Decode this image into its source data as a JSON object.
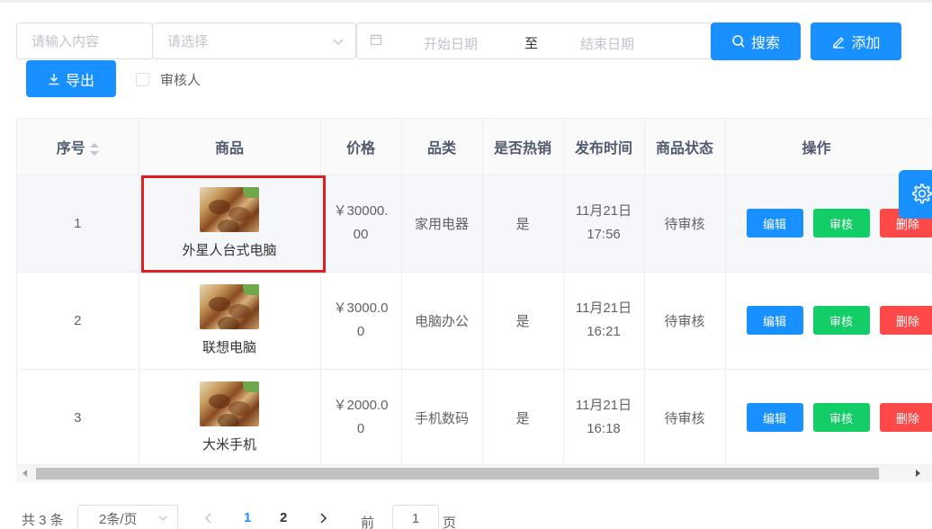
{
  "filters": {
    "keyword_placeholder": "请输入内容",
    "select_placeholder": "请选择",
    "start_date_placeholder": "开始日期",
    "range_separator": "至",
    "end_date_placeholder": "结束日期",
    "search_label": "搜索",
    "add_label": "添加",
    "export_label": "导出",
    "reviewer_checkbox_label": "审核人"
  },
  "table": {
    "columns": {
      "index": "序号",
      "product": "商品",
      "price": "价格",
      "category": "品类",
      "hot": "是否热销",
      "time": "发布时间",
      "status": "商品状态",
      "actions": "操作"
    },
    "rows": [
      {
        "index": "1",
        "name": "外星人台式电脑",
        "price_line1": "￥30000.",
        "price_line2": "00",
        "category": "家用电器",
        "hot": "是",
        "date": "11月21日",
        "time": "17:56",
        "status": "待审核"
      },
      {
        "index": "2",
        "name": "联想电脑",
        "price_line1": "￥3000.0",
        "price_line2": "0",
        "category": "电脑办公",
        "hot": "是",
        "date": "11月21日",
        "time": "16:21",
        "status": "待审核"
      },
      {
        "index": "3",
        "name": "大米手机",
        "price_line1": "￥2000.0",
        "price_line2": "0",
        "category": "手机数码",
        "hot": "是",
        "date": "11月21日",
        "time": "16:18",
        "status": "待审核"
      }
    ],
    "action_labels": {
      "edit": "编辑",
      "audit": "审核",
      "delete": "删除"
    }
  },
  "pagination": {
    "total_text": "共 3 条",
    "page_size": "2条/页",
    "pages": [
      "1",
      "2"
    ],
    "current_page": "1",
    "goto_label": "前往",
    "goto_value": "1",
    "page_unit": "页"
  },
  "colors": {
    "primary": "#1890ff",
    "success": "#13ce66",
    "danger": "#ff4949",
    "highlight": "#e02020"
  }
}
